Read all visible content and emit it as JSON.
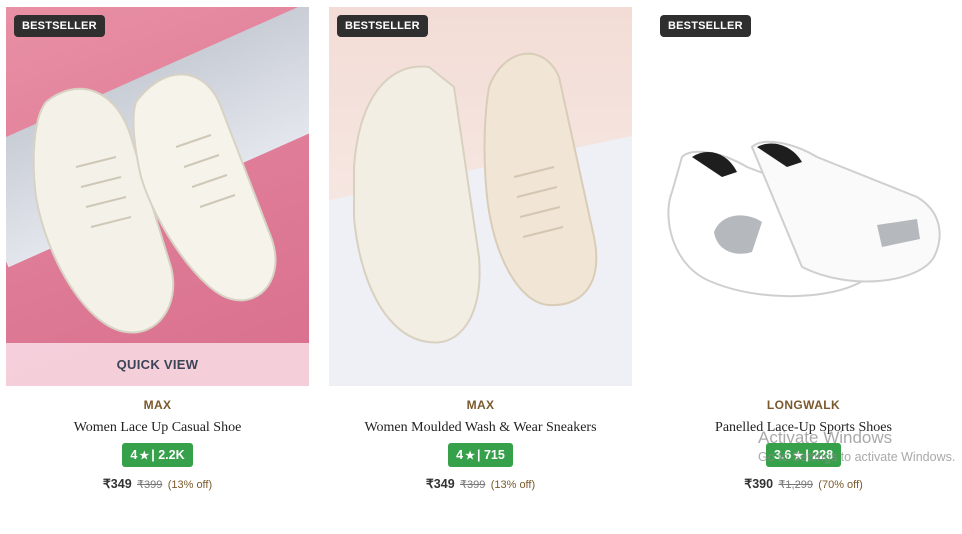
{
  "colors": {
    "badge_bg": "#2f2f2f",
    "rating_bg": "#36a04a",
    "brand_text": "#7a5a2c",
    "quick_view_bg": "#f5d4de"
  },
  "products": [
    {
      "badge": "BESTSELLER",
      "quick_view": "QUICK VIEW",
      "brand": "MAX",
      "title": "Women Lace Up Casual Shoe",
      "rating": "4",
      "star": "★",
      "rating_count": "| 2.2K",
      "price": "₹349",
      "mrp": "₹399",
      "discount": "(13% off)"
    },
    {
      "badge": "BESTSELLER",
      "brand": "MAX",
      "title": "Women Moulded Wash & Wear Sneakers",
      "rating": "4",
      "star": "★",
      "rating_count": "| 715",
      "price": "₹349",
      "mrp": "₹399",
      "discount": "(13% off)"
    },
    {
      "badge": "BESTSELLER",
      "brand": "LONGWALK",
      "title": "Panelled Lace-Up Sports Shoes",
      "rating": "3.6",
      "star": "★",
      "rating_count": "| 228",
      "price": "₹390",
      "mrp": "₹1,299",
      "discount": "(70% off)"
    }
  ],
  "watermark": {
    "line1": "Activate Windows",
    "line2": "Go to Settings to activate Windows."
  }
}
